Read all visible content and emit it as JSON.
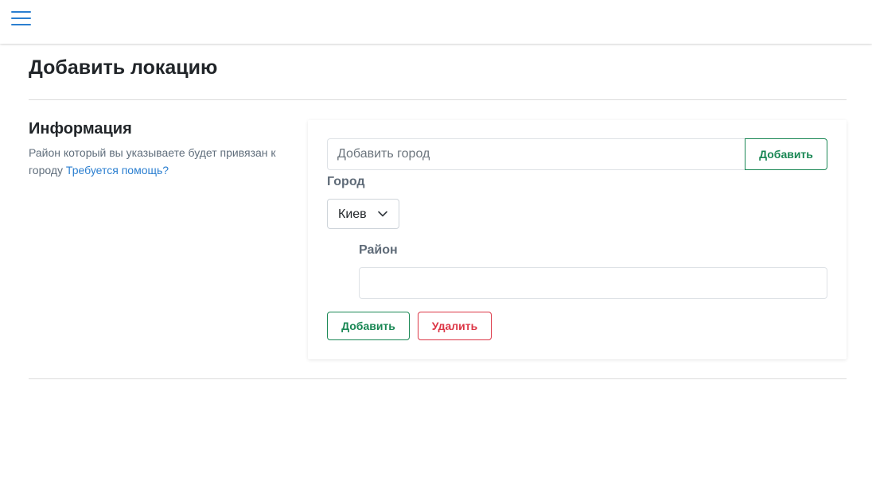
{
  "header": {
    "menu_icon": "hamburger-menu-icon",
    "accent_color": "#2b7fd0"
  },
  "page": {
    "title": "Добавить локацию"
  },
  "info": {
    "title": "Информация",
    "description": "Район который вы указываете будет привязан к городу",
    "help_link": "Требуется помощь?"
  },
  "form": {
    "city_input": {
      "placeholder": "Добавить город",
      "value": ""
    },
    "add_city_button": "Добавить",
    "city_label": "Город",
    "city_select": {
      "selected": "Киев",
      "icon": "chevron-down-icon"
    },
    "district_label": "Район",
    "district_input": {
      "value": ""
    },
    "add_button": "Добавить",
    "delete_button": "Удалить"
  },
  "colors": {
    "success": "#198754",
    "danger": "#dc3545",
    "link": "#2b7fd0"
  }
}
